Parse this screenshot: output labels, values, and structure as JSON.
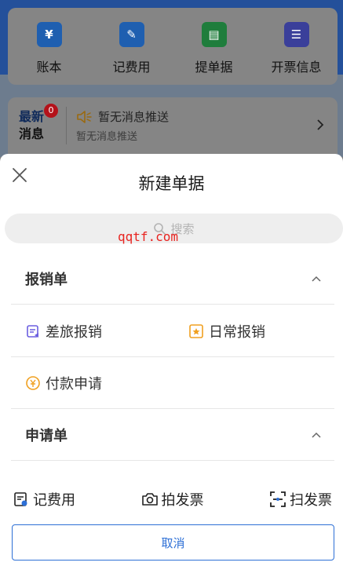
{
  "quick_actions": [
    {
      "label": "账本",
      "icon": "ledger-icon",
      "glyph": "¥",
      "color": "#1f5fb0"
    },
    {
      "label": "记费用",
      "icon": "notebook-icon",
      "glyph": "✎",
      "color": "#1f5fb0"
    },
    {
      "label": "提单据",
      "icon": "printer-icon",
      "glyph": "▤",
      "color": "#1f7d3c"
    },
    {
      "label": "开票信息",
      "icon": "ticket-icon",
      "glyph": "☰",
      "color": "#3a3f9a"
    }
  ],
  "message": {
    "logo_line1": "最新",
    "logo_line2": "消息",
    "badge": "0",
    "title": "暂无消息推送",
    "subtitle": "暂无消息推送"
  },
  "sheet": {
    "title": "新建单据",
    "search_placeholder": "搜索",
    "watermark": "qqtf.com"
  },
  "sections": [
    {
      "title": "报销单",
      "items": [
        {
          "label": "差旅报销",
          "icon": "travel-reimburse-icon"
        },
        {
          "label": "日常报销",
          "icon": "daily-reimburse-icon"
        },
        {
          "label": "付款申请",
          "icon": "payment-request-icon"
        }
      ]
    },
    {
      "title": "申请单",
      "items": []
    }
  ],
  "bottom_bar": {
    "record_expense": "记费用",
    "photo_invoice": "拍发票",
    "scan_invoice": "扫发票"
  },
  "cancel_label": "取消",
  "colors": {
    "accent": "#2d6fd6",
    "icon_purple": "#6b5fe0",
    "icon_orange": "#f0a020"
  }
}
